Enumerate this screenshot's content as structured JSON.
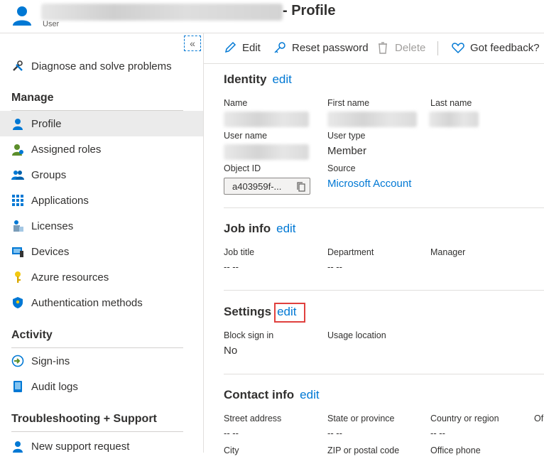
{
  "header": {
    "title_suffix": "- Profile",
    "subtitle": "User"
  },
  "sidebar": {
    "diagnose": "Diagnose and solve problems",
    "manage_heading": "Manage",
    "manage_items": [
      "Profile",
      "Assigned roles",
      "Groups",
      "Applications",
      "Licenses",
      "Devices",
      "Azure resources",
      "Authentication methods"
    ],
    "activity_heading": "Activity",
    "activity_items": [
      "Sign-ins",
      "Audit logs"
    ],
    "troubleshoot_heading": "Troubleshooting + Support",
    "troubleshoot_items": [
      "New support request"
    ],
    "collapse_glyph": "«"
  },
  "toolbar": {
    "edit": "Edit",
    "reset_password": "Reset password",
    "delete": "Delete",
    "feedback": "Got feedback?"
  },
  "identity": {
    "heading": "Identity",
    "edit": "edit",
    "name_label": "Name",
    "first_name_label": "First name",
    "last_name_label": "Last name",
    "user_name_label": "User name",
    "user_type_label": "User type",
    "user_type": "Member",
    "object_id_label": "Object ID",
    "object_id": "a403959f-...",
    "source_label": "Source",
    "source": "Microsoft Account"
  },
  "job_info": {
    "heading": "Job info",
    "edit": "edit",
    "job_title_label": "Job title",
    "job_title": "-- --",
    "department_label": "Department",
    "department": "-- --",
    "manager_label": "Manager"
  },
  "settings": {
    "heading": "Settings",
    "edit": "edit",
    "block_sign_in_label": "Block sign in",
    "block_sign_in": "No",
    "usage_location_label": "Usage location"
  },
  "contact_info": {
    "heading": "Contact info",
    "edit": "edit",
    "street_label": "Street address",
    "street": "-- --",
    "state_label": "State or province",
    "state": "-- --",
    "country_label": "Country or region",
    "country": "-- --",
    "of_label": "Of",
    "city_label": "City",
    "zip_label": "ZIP or postal code",
    "office_phone_label": "Office phone"
  }
}
